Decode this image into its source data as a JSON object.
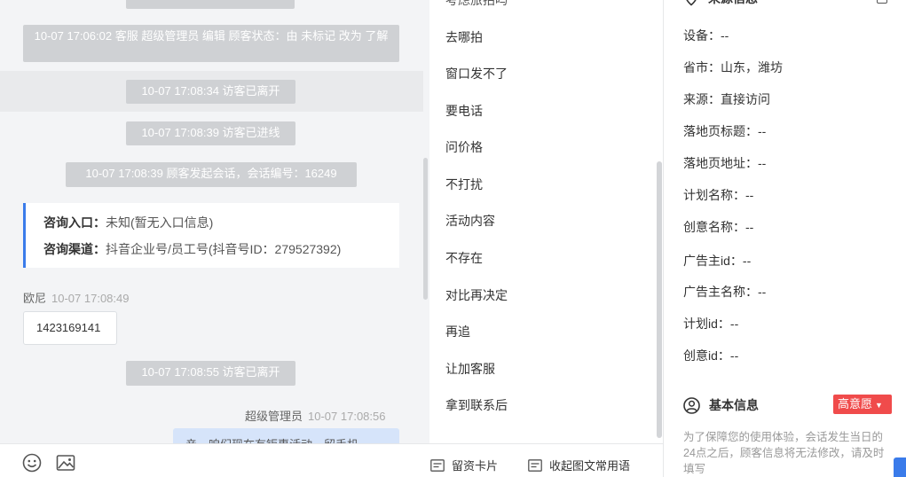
{
  "chat": {
    "messages": [
      {
        "text": "10-07 17:06:02 客服 超级管理员 编辑 顾客状态：由 未标记 改为 了解"
      },
      {
        "text": "10-07 17:08:34 访客已离开"
      },
      {
        "text": "10-07 17:08:39 访客已进线"
      },
      {
        "text": "10-07 17:08:39 顾客发起会话，会话编号：16249"
      },
      {
        "text": "10-07 17:08:55 访客已离开"
      }
    ],
    "card": {
      "entry_label": "咨询入口：",
      "entry_value": "未知(暂无入口信息)",
      "channel_label": "咨询渠道：",
      "channel_value": "抖音企业号/员工号(抖音号ID：279527392)"
    },
    "visitor_msg": {
      "sender": "欧尼",
      "time": "10-07 17:08:49",
      "text": "1423169141"
    },
    "agent_msg": {
      "sender": "超级管理员",
      "time": "10-07 17:08:56",
      "text": "亲，咱们现在有钜惠活动，留手机"
    }
  },
  "toolbar": {
    "emoji_icon": "smile-icon",
    "image_icon": "image-icon",
    "card_btn": "留资卡片",
    "collapse_btn": "收起图文常用语"
  },
  "phrases": [
    "去哪拍",
    "窗口发不了",
    "要电话",
    "问价格",
    "不打扰",
    "活动内容",
    "不存在",
    "对比再决定",
    "再追",
    "让加客服",
    "拿到联系后"
  ],
  "info": {
    "source_title": "来源信息",
    "fields": [
      {
        "label": "设备：",
        "value": "--"
      },
      {
        "label": "省市：",
        "value": "山东，潍坊"
      },
      {
        "label": "来源：",
        "value": "直接访问"
      },
      {
        "label": "落地页标题：",
        "value": "--"
      },
      {
        "label": "落地页地址：",
        "value": "--"
      },
      {
        "label": "计划名称：",
        "value": "--"
      },
      {
        "label": "创意名称：",
        "value": "--"
      },
      {
        "label": "广告主id：",
        "value": "--"
      },
      {
        "label": "广告主名称：",
        "value": "--"
      },
      {
        "label": "计划id：",
        "value": "--"
      },
      {
        "label": "创意id：",
        "value": "--"
      }
    ],
    "basic_title": "基本信息",
    "intent_badge": "高意愿",
    "note": "为了保障您的使用体验，会话发生当日的24点之后，顾客信息将无法修改，请及时填写"
  },
  "colors": {
    "accent": "#3a7bea",
    "badge": "#f04b4b",
    "system_msg": "#cfd1d4"
  }
}
